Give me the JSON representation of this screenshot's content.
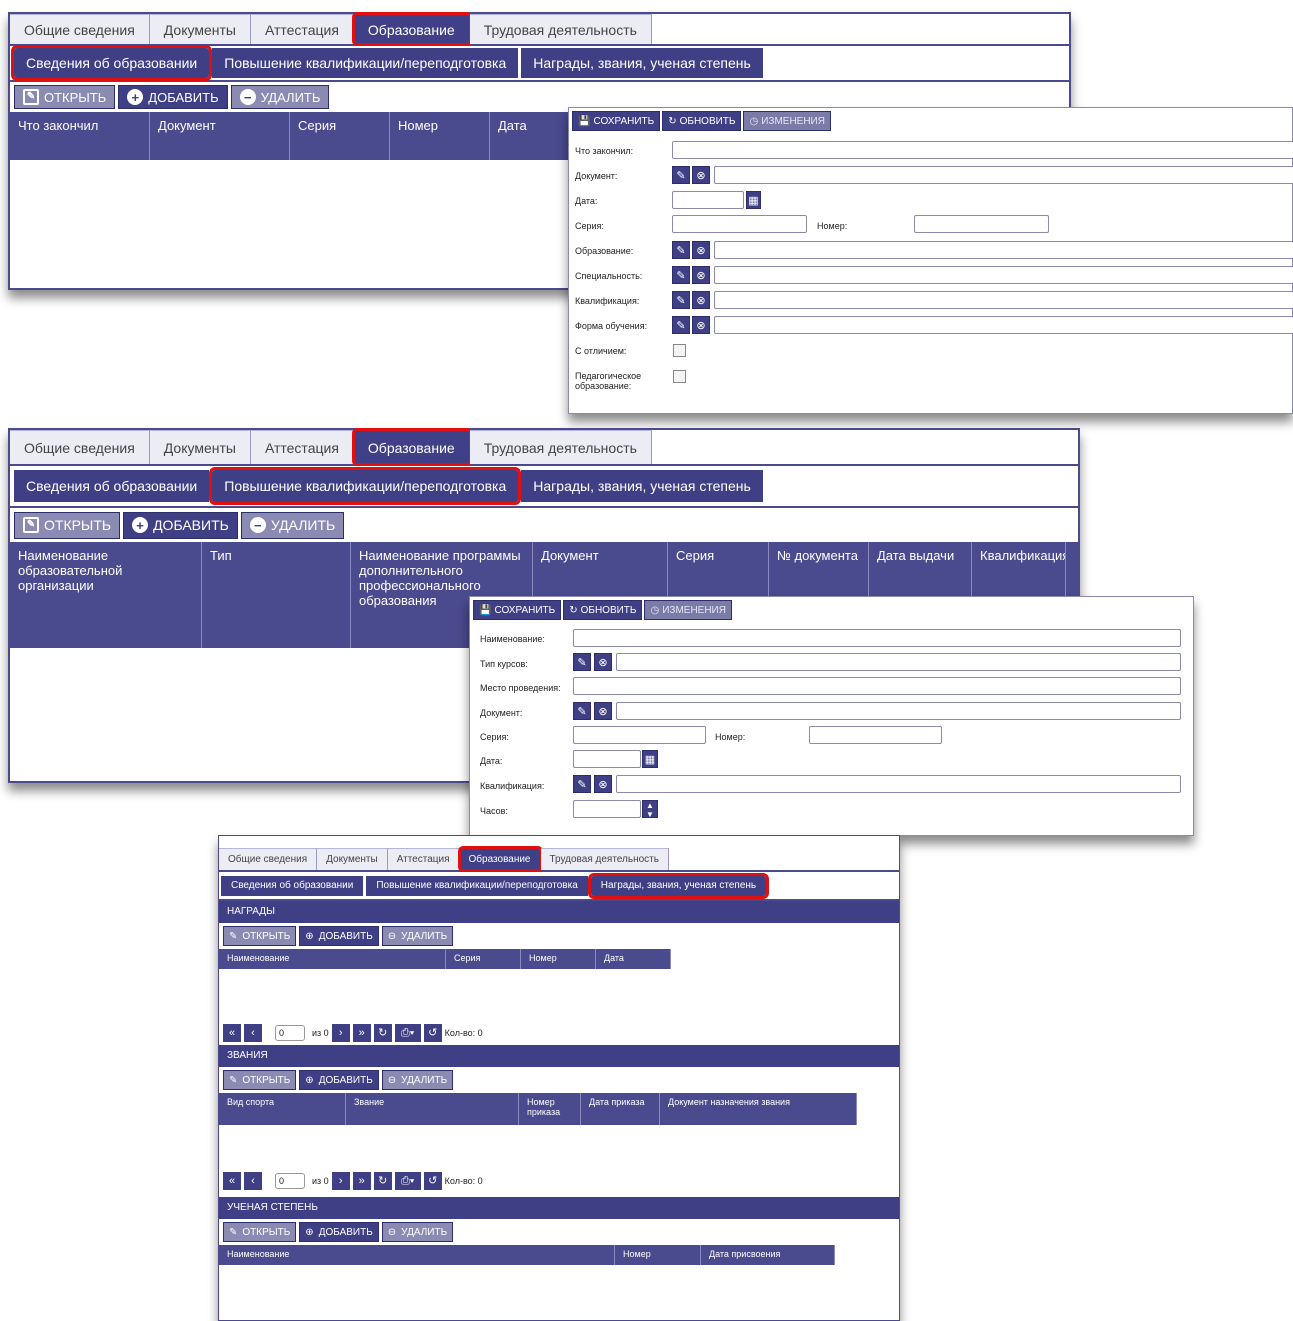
{
  "main_tabs": [
    "Общие сведения",
    "Документы",
    "Аттестация",
    "Образование",
    "Трудовая деятельность"
  ],
  "sub_tabs": [
    "Сведения об образовании",
    "Повышение квалификации/переподготовка",
    "Награды, звания, ученая степень"
  ],
  "toolbar": {
    "open": "ОТКРЫТЬ",
    "add": "ДОБАВИТЬ",
    "delete": "УДАЛИТЬ"
  },
  "form_toolbar": {
    "save": "СОХРАНИТЬ",
    "refresh": "ОБНОВИТЬ",
    "changes": "ИЗМЕНЕНИЯ"
  },
  "panel1": {
    "columns": [
      "Что закончил",
      "Документ",
      "Серия",
      "Номер",
      "Дата"
    ],
    "form": {
      "labels": [
        "Что закончил:",
        "Документ:",
        "Дата:",
        "Серия:",
        "Номер:",
        "Образование:",
        "Специальность:",
        "Квалификация:",
        "Форма обучения:",
        "С отличием:",
        "Педагогическое образование:"
      ]
    }
  },
  "panel2": {
    "columns": [
      "Наименование образовательной организации",
      "Тип",
      "Наименование программы дополнительного профессионального образования",
      "Документ",
      "Серия",
      "№ документа",
      "Дата выдачи",
      "Квалификация"
    ],
    "form": {
      "labels": [
        "Наименование:",
        "Тип курсов:",
        "Место проведения:",
        "Документ:",
        "Серия:",
        "Номер:",
        "Дата:",
        "Квалификация:",
        "Часов:"
      ]
    }
  },
  "panel3": {
    "awards": {
      "title": "НАГРАДЫ",
      "columns": [
        "Наименование",
        "Серия",
        "Номер",
        "Дата"
      ]
    },
    "titles": {
      "title": "ЗВАНИЯ",
      "columns": [
        "Вид спорта",
        "Звание",
        "Номер приказа",
        "Дата приказа",
        "Документ назначения звания"
      ]
    },
    "degree": {
      "title": "УЧЕНАЯ СТЕПЕНЬ",
      "columns": [
        "Наименование",
        "Номер",
        "Дата присвоения"
      ]
    },
    "pager": {
      "page": "0",
      "of": "из 0",
      "count": "Кол-во: 0"
    }
  }
}
